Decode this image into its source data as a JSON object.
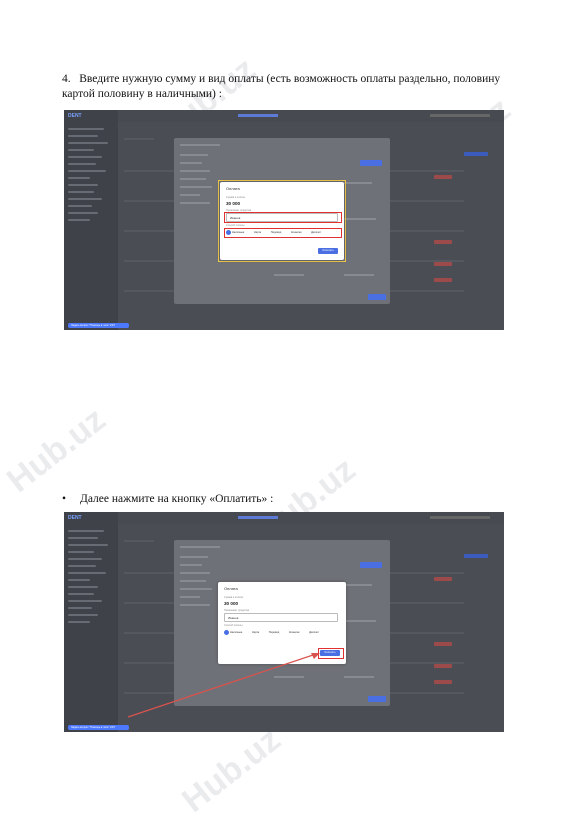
{
  "watermark": "Hub.uz",
  "step1": {
    "number": "4.",
    "text": "Введите нужную сумму и вид оплаты (есть возможность оплаты раздельно, половину картой половину в наличными) :"
  },
  "step2": {
    "bullet": "•",
    "text": "Далее нажмите на кнопку «Оплатить» :"
  },
  "app": {
    "logo": "DENT",
    "help_button": "Задать вопрос \"Помощь в чате\" 24/7"
  },
  "dialog": {
    "title": "Оплата",
    "amount_label": "Сумма к оплате",
    "amount": "30 000",
    "cashier_label": "Принимает средства",
    "cashier_value": "Иванов",
    "method_label": "Способ оплаты",
    "methods": [
      "Наличные",
      "Карта",
      "Перевод",
      "Кошелек",
      "Депозит"
    ],
    "pay_button": "Оплатить"
  },
  "colors": {
    "accent": "#4a6fe3",
    "highlight_yellow": "#f2c94c",
    "highlight_red": "#e03030",
    "arrow": "#d9534f"
  }
}
